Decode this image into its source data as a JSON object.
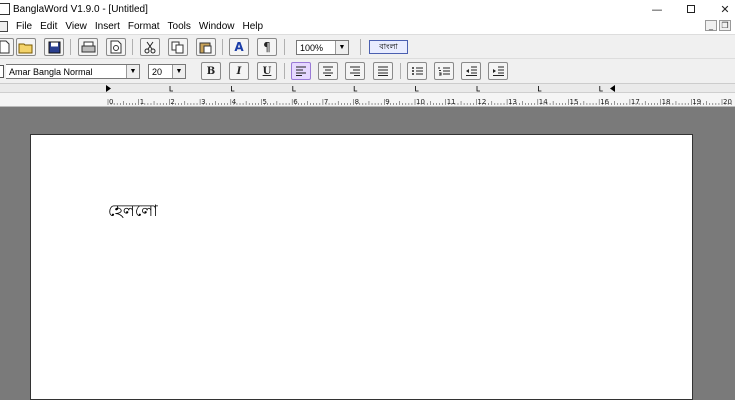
{
  "window": {
    "title": "BanglaWord V1.9.0 - [Untitled]",
    "minimize_glyph": "—",
    "close_glyph": "✕"
  },
  "menu": {
    "items": [
      "File",
      "Edit",
      "View",
      "Insert",
      "Format",
      "Tools",
      "Window",
      "Help"
    ]
  },
  "mdi": {
    "minimize_glyph": "_",
    "restore_glyph": "❐"
  },
  "toolbar": {
    "zoom_value": "100%",
    "language_label": "বাংলা",
    "font_value": "Amar Bangla Normal",
    "size_value": "20",
    "bold_glyph": "B",
    "italic_glyph": "I",
    "underline_glyph": "U",
    "pilcrow_glyph": "¶",
    "font_color_glyph": "A",
    "dropdown_glyph": "▼"
  },
  "ruler": {
    "tick_labels": [
      "0",
      "1",
      "2",
      "3",
      "4",
      "5",
      "6",
      "7",
      "8",
      "9",
      "10",
      "11",
      "12",
      "13",
      "14",
      "15",
      "16",
      "17",
      "18",
      "19",
      "20"
    ]
  },
  "document": {
    "text": "হেললো"
  },
  "colors": {
    "workspace": "#7a7a7a",
    "toolbar": "#f0f0f0",
    "active_button": "#e6d8ff",
    "language_button": "#e8ecff"
  }
}
